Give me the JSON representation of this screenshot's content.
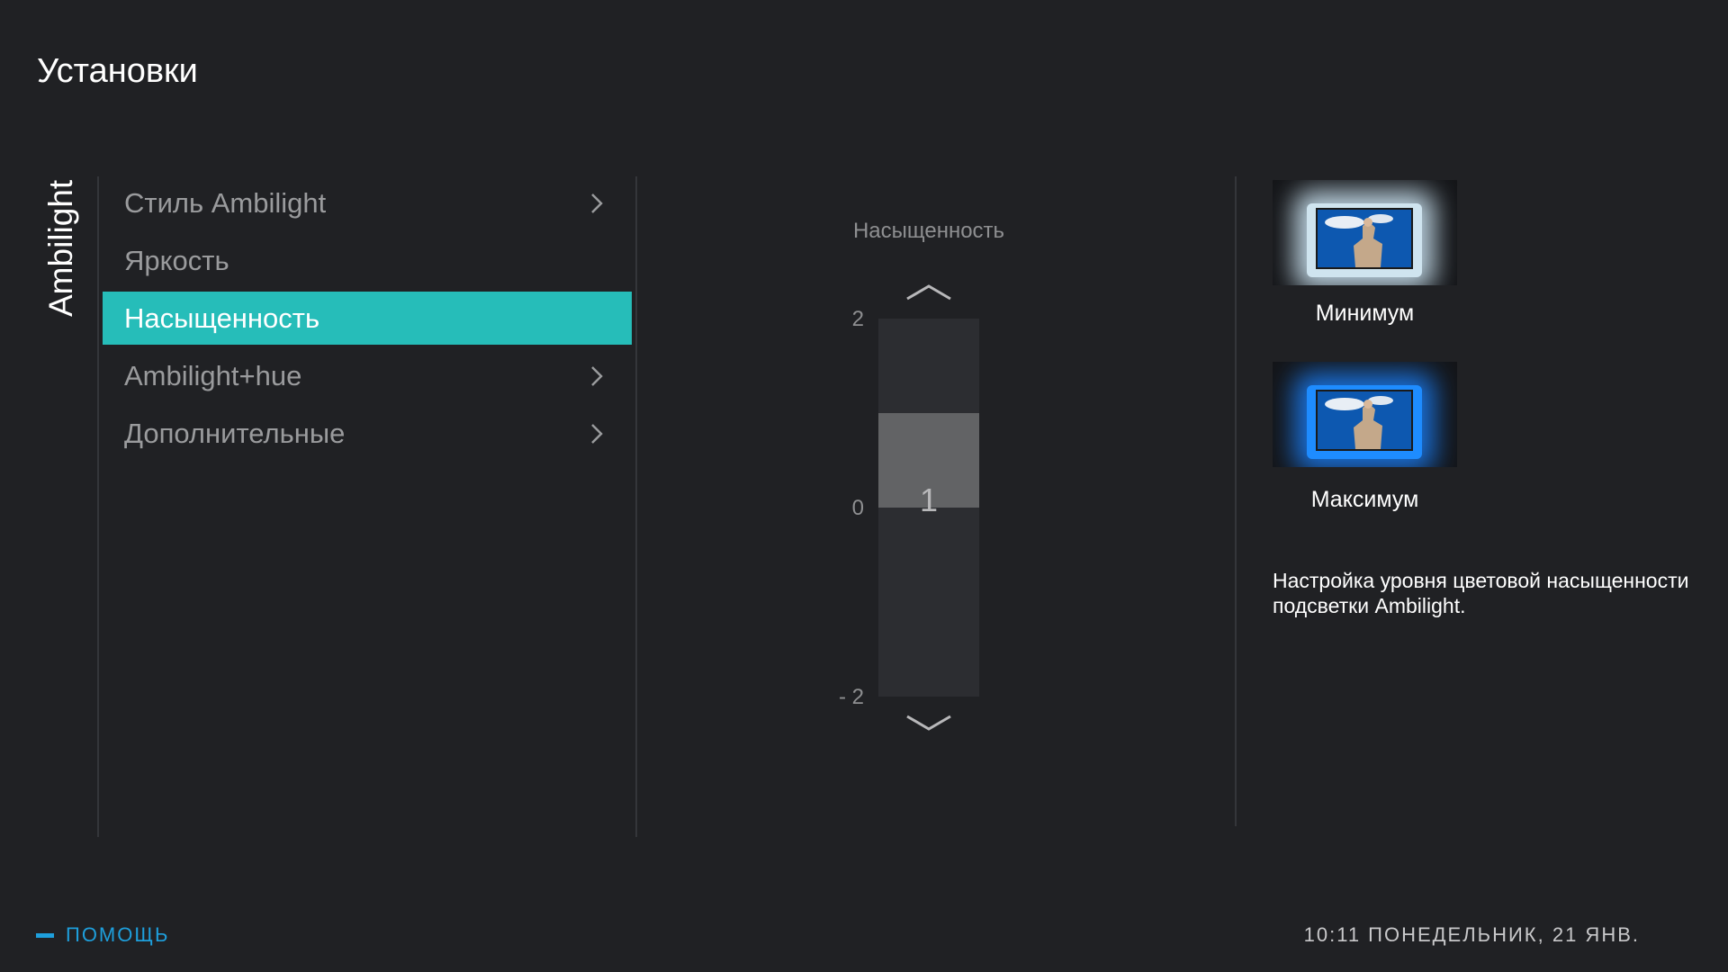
{
  "page": {
    "title": "Установки"
  },
  "section_tab": {
    "label": "Ambilight"
  },
  "menu": {
    "items": [
      {
        "label": "Стиль Ambilight",
        "has_submenu": true
      },
      {
        "label": "Яркость",
        "has_submenu": false
      },
      {
        "label": "Насыщенность",
        "has_submenu": false,
        "selected": true
      },
      {
        "label": "Ambilight+hue",
        "has_submenu": true
      },
      {
        "label": "Дополнительные",
        "has_submenu": true
      }
    ]
  },
  "slider": {
    "title": "Насыщенность",
    "value": "1",
    "max_label": "2",
    "mid_label": "0",
    "min_label": "- 2",
    "level": 1,
    "min": -2,
    "max": 2
  },
  "previews": {
    "minimum": {
      "label": "Минимум",
      "glow_color": "#cfe4ef"
    },
    "maximum": {
      "label": "Максимум",
      "glow_color": "#1e8cff"
    }
  },
  "description": "Настройка уровня цветовой насыщенности подсветки Ambilight.",
  "footer": {
    "help_label": "ПОМОЩЬ",
    "clock": "10:11 ПОНЕДЕЛЬНИК, 21 ЯНВ."
  },
  "colors": {
    "accent_selected": "#26bdb9",
    "help_blue": "#1e9fdc",
    "background": "#202124"
  }
}
